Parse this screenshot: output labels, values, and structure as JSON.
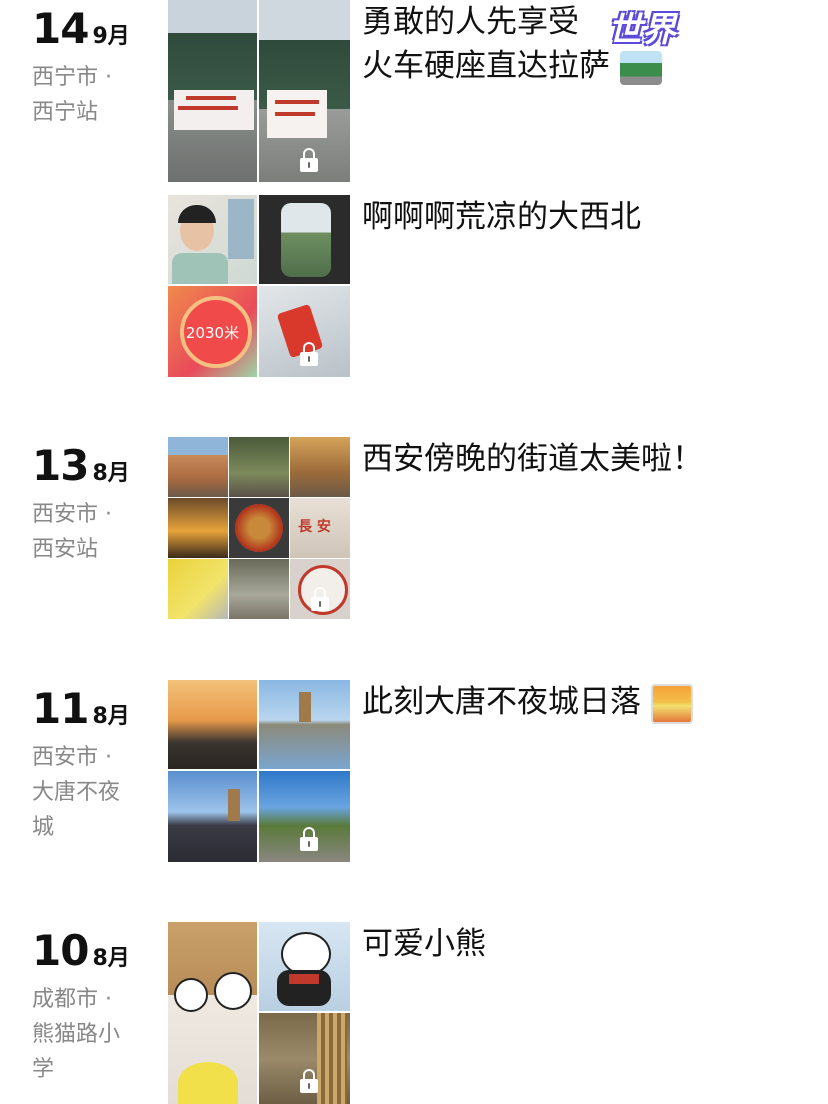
{
  "entries": [
    {
      "day": "14",
      "month": "9月",
      "location": [
        "西宁市 ·",
        "西宁站"
      ],
      "posts": [
        {
          "caption": [
            "勇敢的人先享受",
            "火车硬座直达拉萨"
          ],
          "sticker": "世界",
          "caption_emoji": "train-emoji"
        },
        {
          "caption": [
            "啊啊啊荒凉的大西北"
          ],
          "step_count": "2030米"
        }
      ]
    },
    {
      "day": "13",
      "month": "8月",
      "location": [
        "西安市 ·",
        "西安站"
      ],
      "posts": [
        {
          "caption": [
            "西安傍晚的街道太美啦！"
          ]
        }
      ]
    },
    {
      "day": "11",
      "month": "8月",
      "location": [
        "西安市 ·",
        "大唐不夜",
        "城"
      ],
      "posts": [
        {
          "caption": [
            "此刻大唐不夜城日落"
          ],
          "caption_emoji": "sunset-emoji"
        }
      ]
    },
    {
      "day": "10",
      "month": "8月",
      "location": [
        "成都市 ·",
        "熊猫路小",
        "学"
      ],
      "posts": [
        {
          "caption": [
            "可爱小熊"
          ]
        }
      ]
    }
  ],
  "colors": {
    "date": "#111111",
    "location": "#888888",
    "caption": "#111111",
    "sticker_outline": "#5b4bd8"
  }
}
